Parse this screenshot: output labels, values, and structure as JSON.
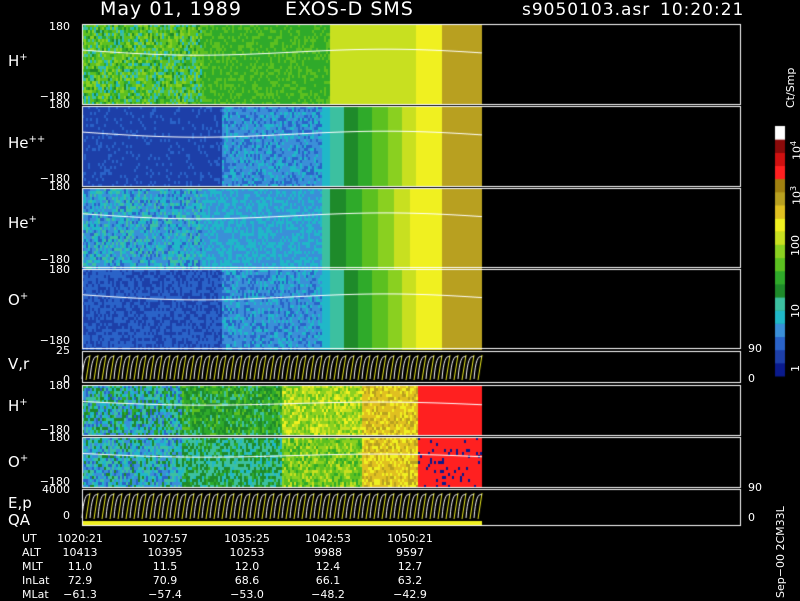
{
  "header": {
    "date": "May 01, 1989",
    "instrument": "EXOS-D SMS",
    "file": "s9050103.asr",
    "time": "10:20:21"
  },
  "panels": [
    {
      "species": "H",
      "charge": "+",
      "top": "180",
      "bottom": "−180"
    },
    {
      "species": "He",
      "charge": "++",
      "top": "180",
      "bottom": "−180"
    },
    {
      "species": "He",
      "charge": "+",
      "top": "180",
      "bottom": "−180"
    },
    {
      "species": "O",
      "charge": "+",
      "top": "180",
      "bottom": "−180"
    },
    {
      "species": "V,r",
      "charge": "",
      "top": "25",
      "bottom": "0",
      "right_top": "90",
      "right_bottom": "0"
    },
    {
      "species": "H",
      "charge": "+",
      "top": "180",
      "bottom": "−180"
    },
    {
      "species": "O",
      "charge": "+",
      "top": "180",
      "bottom": "−180"
    },
    {
      "species": "E,p",
      "charge": "",
      "top": "4000",
      "bottom": "0",
      "right_top": "90",
      "right_bottom": "0",
      "sub": "QA"
    }
  ],
  "colorbar": {
    "unit": "Ct/Smp",
    "labels": [
      {
        "base": "10",
        "exp": "4"
      },
      {
        "base": "10",
        "exp": "3"
      },
      {
        "base": "100",
        "exp": ""
      },
      {
        "base": "10",
        "exp": ""
      },
      {
        "base": "1",
        "exp": ""
      }
    ],
    "colors": [
      "#0a1a8c",
      "#1d3fa8",
      "#2a63c8",
      "#3a8fd8",
      "#20b8c8",
      "#3cc0a0",
      "#1e8a2a",
      "#2faa2a",
      "#5cc020",
      "#8ad020",
      "#c8e020",
      "#f0f020",
      "#e0c020",
      "#b8a020",
      "#a08010",
      "#ff2020",
      "#d01010",
      "#8a0a0a",
      "#ffffff"
    ]
  },
  "ephemeris": {
    "rows": [
      {
        "label": "UT",
        "values": [
          "1020:21",
          "1027:57",
          "1035:25",
          "1042:53",
          "1050:21"
        ]
      },
      {
        "label": "ALT",
        "values": [
          "10413",
          "10395",
          "10253",
          "9988",
          "9597"
        ]
      },
      {
        "label": "MLT",
        "values": [
          "11.0",
          "11.5",
          "12.0",
          "12.4",
          "12.7"
        ]
      },
      {
        "label": "InLat",
        "values": [
          "72.9",
          "70.9",
          "68.6",
          "66.1",
          "63.2"
        ]
      },
      {
        "label": "MLat",
        "values": [
          "−61.3",
          "−57.4",
          "−53.0",
          "−48.2",
          "−42.9"
        ]
      }
    ]
  },
  "footer_note": "Sep−00 2CM33L",
  "chart_data": {
    "type": "heatmap",
    "title": "May 01, 1989   EXOS-D SMS",
    "xlabel": "UT",
    "x": [
      "1020:21",
      "1027:57",
      "1035:25",
      "1042:53",
      "1050:21"
    ],
    "series": [
      {
        "name": "H+",
        "ylim": [
          -180,
          180
        ]
      },
      {
        "name": "He++",
        "ylim": [
          -180,
          180
        ]
      },
      {
        "name": "He+",
        "ylim": [
          -180,
          180
        ]
      },
      {
        "name": "O+",
        "ylim": [
          -180,
          180
        ]
      },
      {
        "name": "V,r",
        "ylim": [
          0,
          25
        ]
      },
      {
        "name": "H+",
        "ylim": [
          -180,
          180
        ]
      },
      {
        "name": "O+",
        "ylim": [
          -180,
          180
        ]
      },
      {
        "name": "E,p",
        "ylim": [
          0,
          4000
        ]
      }
    ],
    "colorbar_range": [
      1,
      10000
    ],
    "colorbar_scale": "log"
  }
}
